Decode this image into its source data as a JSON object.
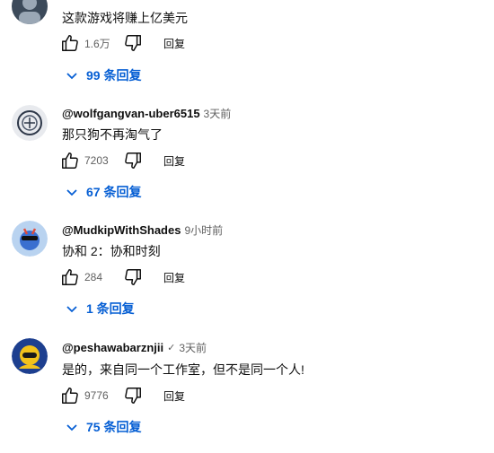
{
  "comments": [
    {
      "author": "",
      "time": "",
      "text": "这款游戏将赚上亿美元",
      "likes": "1.6万",
      "reply_label": "回复",
      "replies_label": "99 条回复",
      "avatar_colors": [
        "#3c4a5a",
        "#9aa7b5"
      ]
    },
    {
      "author": "@wolfgangvan-uber6515",
      "time": "3天前",
      "text": "那只狗不再淘气了",
      "likes": "7203",
      "reply_label": "回复",
      "replies_label": "67 条回复",
      "avatar_colors": [
        "#e8eaee",
        "#2d3748"
      ]
    },
    {
      "author": "@MudkipWithShades",
      "time": "9小时前",
      "text": "协和 2：协和时刻",
      "likes": "284",
      "reply_label": "回复",
      "replies_label": "1 条回复",
      "avatar_colors": [
        "#b9d3f0",
        "#3a6fd0"
      ]
    },
    {
      "author": "@peshawabarznjii",
      "verified": "✓",
      "time": "3天前",
      "text": "是的，来自同一个工作室，但不是同一个人!",
      "likes": "9776",
      "reply_label": "回复",
      "replies_label": "75 条回复",
      "avatar_colors": [
        "#1d3f8f",
        "#f2c21b"
      ]
    }
  ],
  "colors": {
    "link": "#065fd4",
    "meta": "#606060",
    "text": "#0f0f0f"
  }
}
